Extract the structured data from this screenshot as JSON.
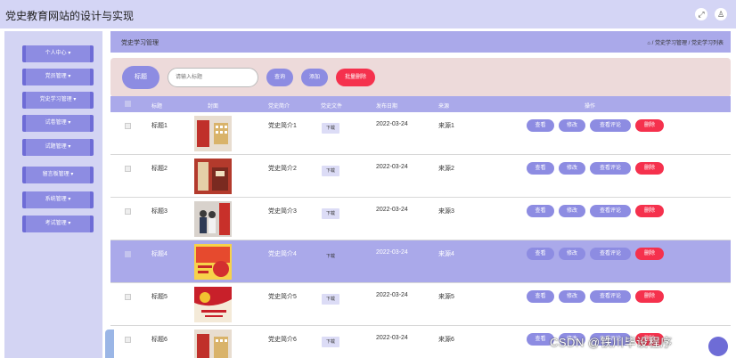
{
  "app": {
    "title": "党史教育网站的设计与实现"
  },
  "topbar": {
    "icons": [
      "fullscreen-icon",
      "user-icon"
    ]
  },
  "sidebar": {
    "items": [
      {
        "label": "个人中心 ▾"
      },
      {
        "label": "党员管理 ▾"
      },
      {
        "label": "党史学习管理 ▾"
      },
      {
        "label": "试卷管理 ▾"
      },
      {
        "label": "试题管理 ▾"
      },
      {
        "label": "留言板管理 ▾"
      },
      {
        "label": "系统管理 ▾"
      },
      {
        "label": "考试管理 ▾"
      }
    ]
  },
  "breadcrumb": {
    "title": "党史学习管理",
    "path": "⌂ / 党史学习管理 / 党史学习列表"
  },
  "search": {
    "label": "标题",
    "placeholder": "请输入标题",
    "query_btn": "查询",
    "add_btn": "添加",
    "batch_delete_btn": "批量删除"
  },
  "table": {
    "headers": [
      "标题",
      "封面",
      "党史简介",
      "党史文件",
      "发布日期",
      "来源",
      "操作"
    ],
    "rows": [
      {
        "title": "标题1",
        "intro": "党史简介1",
        "file": "下载",
        "date": "2022-03-24",
        "source": "来源1"
      },
      {
        "title": "标题2",
        "intro": "党史简介2",
        "file": "下载",
        "date": "2022-03-24",
        "source": "来源2"
      },
      {
        "title": "标题3",
        "intro": "党史简介3",
        "file": "下载",
        "date": "2022-03-24",
        "source": "来源3"
      },
      {
        "title": "标题4",
        "intro": "党史简介4",
        "file": "下载",
        "date": "2022-03-24",
        "source": "来源4"
      },
      {
        "title": "标题5",
        "intro": "党史简介5",
        "file": "下载",
        "date": "2022-03-24",
        "source": "来源5"
      },
      {
        "title": "标题6",
        "intro": "党史简介6",
        "file": "下载",
        "date": "2022-03-24",
        "source": "来源6"
      }
    ],
    "actions": {
      "view": "查看",
      "edit": "修改",
      "comments": "查看评论",
      "delete": "删除"
    }
  },
  "watermark": "CSDN @铁川毕设程序",
  "colors": {
    "accent": "#8d8ce2",
    "accent_light": "#aaa9ea",
    "danger": "#f5314d",
    "topbar": "#d4d5f5"
  }
}
